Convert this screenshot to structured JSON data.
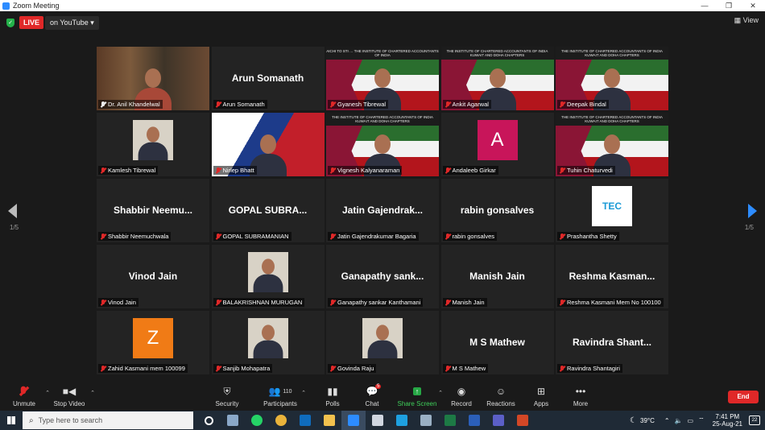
{
  "window": {
    "title": "Zoom Meeting",
    "controls": [
      "—",
      "❐",
      "✕"
    ]
  },
  "topbar": {
    "live": "LIVE",
    "stream": "on YouTube",
    "view": "View"
  },
  "participants": [
    {
      "name": "Dr. Anil Khandelwal",
      "display": "",
      "type": "video",
      "active": true,
      "pinned": true
    },
    {
      "name": "Arun Somanath",
      "display": "Arun Somanath",
      "type": "name"
    },
    {
      "name": "Gyanesh Tibrewal",
      "display": "",
      "type": "flag-video",
      "banner": "AICHI TO STI … THE INSTITUTE OF CHARTERED ACCOUNTANTS OF INDIA"
    },
    {
      "name": "Ankit Agarwal",
      "display": "",
      "type": "flag-video",
      "banner": "THE INSTITUTE OF CHARTERED ACCOUNTANTS OF INDIA KUWAIT AND DOHA CHAPTERS"
    },
    {
      "name": "Deepak Bindal",
      "display": "",
      "type": "flag-video",
      "banner": "THE INSTITUTE OF CHARTERED ACCOUNTANTS OF INDIA KUWAIT AND DOHA CHAPTERS"
    },
    {
      "name": "Kamlesh Tibrewal",
      "display": "",
      "type": "photo"
    },
    {
      "name": "Nirlep Bhatt",
      "display": "",
      "type": "video"
    },
    {
      "name": "Vignesh Kalyanaraman",
      "display": "",
      "type": "flag-video",
      "banner": "THE INSTITUTE OF CHARTERED ACCOUNTANTS OF INDIA KUWAIT AND DOHA CHAPTERS"
    },
    {
      "name": "Andaleeb Girkar",
      "display": "A",
      "type": "letter",
      "color": "#c8155a"
    },
    {
      "name": "Tuhin Chaturvedi",
      "display": "",
      "type": "flag-video",
      "banner": "THE INSTITUTE OF CHARTERED ACCOUNTANTS OF INDIA KUWAIT AND DOHA CHAPTERS"
    },
    {
      "name": "Shabbir Neemuchwala",
      "display": "Shabbir Neemu...",
      "type": "name"
    },
    {
      "name": "GOPAL SUBRAMANIAN",
      "display": "GOPAL SUBRA...",
      "type": "name"
    },
    {
      "name": "Jatin Gajendrakumar Bagaria",
      "display": "Jatin Gajendrak...",
      "type": "name"
    },
    {
      "name": "rabin gonsalves",
      "display": "rabin gonsalves",
      "type": "name"
    },
    {
      "name": "Prashantha Shetty",
      "display": "TEC",
      "type": "logo"
    },
    {
      "name": "Vinod Jain",
      "display": "Vinod Jain",
      "type": "name"
    },
    {
      "name": "BALAKRISHNAN MURUGAN",
      "display": "",
      "type": "photo"
    },
    {
      "name": "Ganapathy sankar Kanthamani",
      "display": "Ganapathy sank...",
      "type": "name"
    },
    {
      "name": "Manish Jain",
      "display": "Manish Jain",
      "type": "name"
    },
    {
      "name": "Reshma Kasmani Mem No 100100",
      "display": "Reshma Kasman...",
      "type": "name"
    },
    {
      "name": "Zahid Kasmani mem 100099",
      "display": "Z",
      "type": "letter",
      "color": "#f07b16"
    },
    {
      "name": "Sanjib Mohapatra",
      "display": "",
      "type": "photo"
    },
    {
      "name": "Govinda Raju",
      "display": "",
      "type": "photo"
    },
    {
      "name": "M S Mathew",
      "display": "M S Mathew",
      "type": "name"
    },
    {
      "name": "Ravindra Shantagiri",
      "display": "Ravindra Shant...",
      "type": "name"
    }
  ],
  "pagination": {
    "left": "1/5",
    "right": "1/5"
  },
  "toolbar": {
    "unmute": "Unmute",
    "stop_video": "Stop Video",
    "security": "Security",
    "participants": "Participants",
    "participants_count": "110",
    "polls": "Polls",
    "chat": "Chat",
    "chat_badge": "5",
    "share_screen": "Share Screen",
    "record": "Record",
    "reactions": "Reactions",
    "apps": "Apps",
    "more": "More",
    "end": "End"
  },
  "taskbar": {
    "search_placeholder": "Type here to search",
    "temperature": "39°C",
    "time": "7:41 PM",
    "date": "25-Aug-21",
    "notifications": "22",
    "apps": [
      "task-view",
      "file-explorer",
      "whatsapp",
      "chrome",
      "outlook",
      "folder",
      "zoom",
      "paint",
      "app-blue",
      "app-grey",
      "excel",
      "word",
      "teams",
      "powerpoint"
    ]
  }
}
